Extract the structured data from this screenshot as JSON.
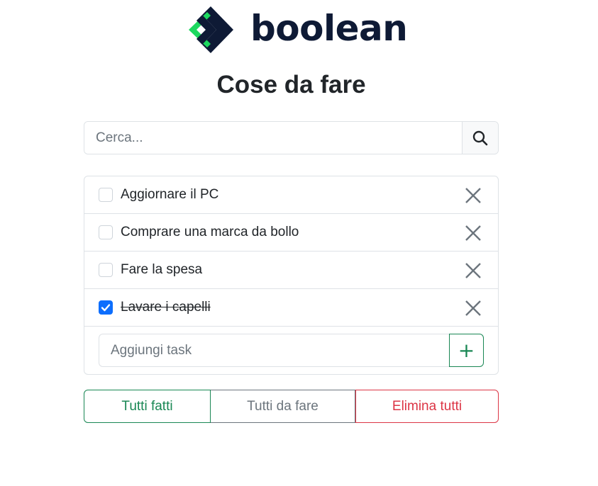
{
  "brand": {
    "name": "boolean",
    "colors": {
      "green": "#1dd85f",
      "navy": "#0e1a35"
    }
  },
  "page_title": "Cose da fare",
  "search": {
    "placeholder": "Cerca...",
    "value": "",
    "icon": "search-icon"
  },
  "tasks": [
    {
      "label": "Aggiornare il PC",
      "done": false
    },
    {
      "label": "Comprare una marca da bollo",
      "done": false
    },
    {
      "label": "Fare la spesa",
      "done": false
    },
    {
      "label": "Lavare i capelli",
      "done": true
    }
  ],
  "add_task": {
    "placeholder": "Aggiungi task",
    "value": "",
    "button_label": "+"
  },
  "actions": {
    "all_done": "Tutti fatti",
    "all_todo": "Tutti da fare",
    "delete_all": "Elimina tutti"
  },
  "colors": {
    "primary": "#0d6efd",
    "success": "#198754",
    "secondary": "#6c757d",
    "danger": "#dc3545",
    "border": "#dee2e6"
  }
}
